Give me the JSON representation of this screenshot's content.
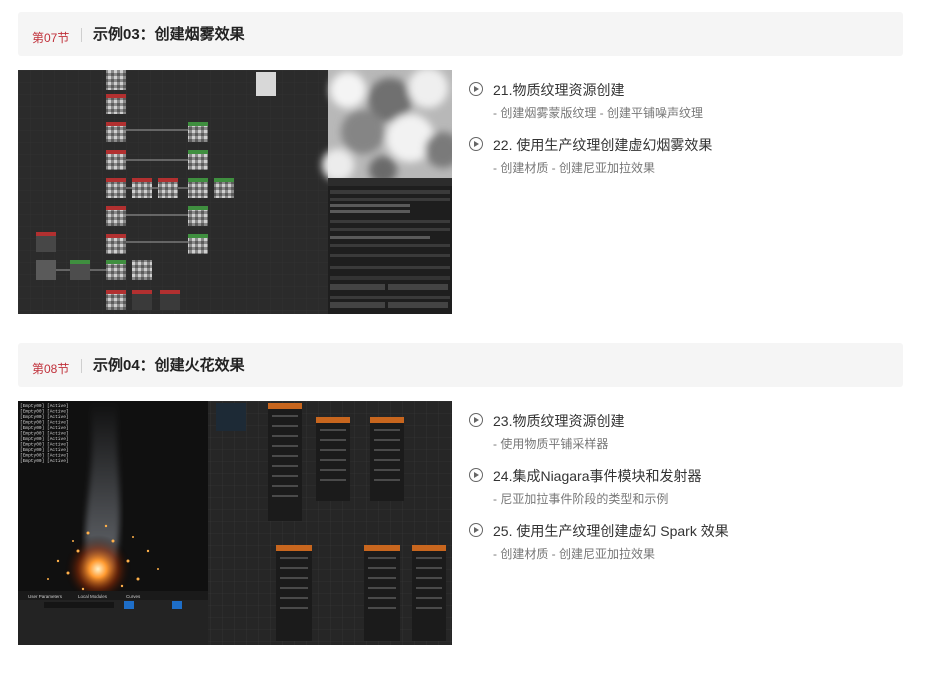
{
  "sections": [
    {
      "number": "第07节",
      "title": "示例03：创建烟雾效果",
      "lessons": [
        {
          "title": "21.物质纹理资源创建",
          "subtitle": "- 创建烟雾蒙版纹理 - 创建平铺噪声纹理"
        },
        {
          "title": "22. 使用生产纹理创建虚幻烟雾效果",
          "subtitle": "- 创建材质 - 创建尼亚加拉效果"
        }
      ]
    },
    {
      "number": "第08节",
      "title": "示例04：创建火花效果",
      "lessons": [
        {
          "title": "23.物质纹理资源创建",
          "subtitle": "- 使用物质平铺采样器"
        },
        {
          "title": "24.集成Niagara事件模块和发射器",
          "subtitle": "- 尼亚加拉事件阶段的类型和示例"
        },
        {
          "title": "25. 使用生产纹理创建虚幻 Spark 效果",
          "subtitle": "- 创建材质 - 创建尼亚加拉效果"
        }
      ]
    }
  ],
  "screenshot2": {
    "panel_tabs": [
      "User Parameters",
      "Local Modules",
      "Curves"
    ],
    "log_lines": [
      "[Empty00] [Active]",
      "[Empty00] [Active]",
      "[Empty00] [Active]",
      "[Empty00] [Active]",
      "[Empty00] [Active]",
      "[Empty00] [Active]",
      "[Empty00] [Active]",
      "[Empty00] [Active]",
      "[Empty00] [Active]",
      "[Empty00] [Active]",
      "[Empty00] [Active]"
    ]
  }
}
